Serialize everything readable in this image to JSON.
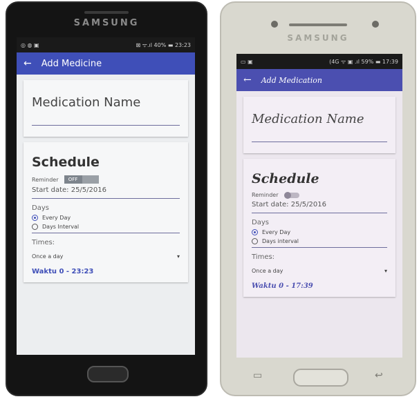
{
  "left": {
    "brand": "SAMSUNG",
    "status": {
      "left_icons": "◎ ◍ ▣",
      "right_text": "⊠ ᯤ.ıl 40% ▬ 23:23"
    },
    "appbar": {
      "back": "←",
      "title": "Add Medicine"
    },
    "med_name_placeholder": "Medication Name",
    "schedule": {
      "title": "Schedule",
      "reminder_label": "Reminder",
      "toggle_state": "OFF",
      "start_date": "Start date: 25/5/2016",
      "days_label": "Days",
      "option_every_day": "Every Day",
      "option_days_interval": "Days Interval",
      "times_label": "Times:",
      "times_value": "Once a day",
      "waktu": "Waktu 0 - 23:23"
    }
  },
  "right": {
    "brand": "SAMSUNG",
    "status": {
      "left_icons": "▭ ▣",
      "right_text": "(4G ᯤ ▣ .ıl 59% ▬ 17:39"
    },
    "appbar": {
      "back": "←",
      "title": "Add Medication"
    },
    "med_name_placeholder": "Medication Name",
    "schedule": {
      "title": "Schedule",
      "reminder_label": "Reminder",
      "start_date": "Start date: 25/5/2016",
      "days_label": "Days",
      "option_every_day": "Every Day",
      "option_days_interval": "Days interval",
      "times_label": "Times:",
      "times_value": "Once a day",
      "waktu": "Waktu 0 - 17:39"
    }
  },
  "icons": {
    "back": "arrow-left-icon",
    "dropdown": "triangle-down-icon"
  },
  "colors": {
    "appbar_left": "#3f4fb8",
    "appbar_right": "#4b4fb0"
  }
}
